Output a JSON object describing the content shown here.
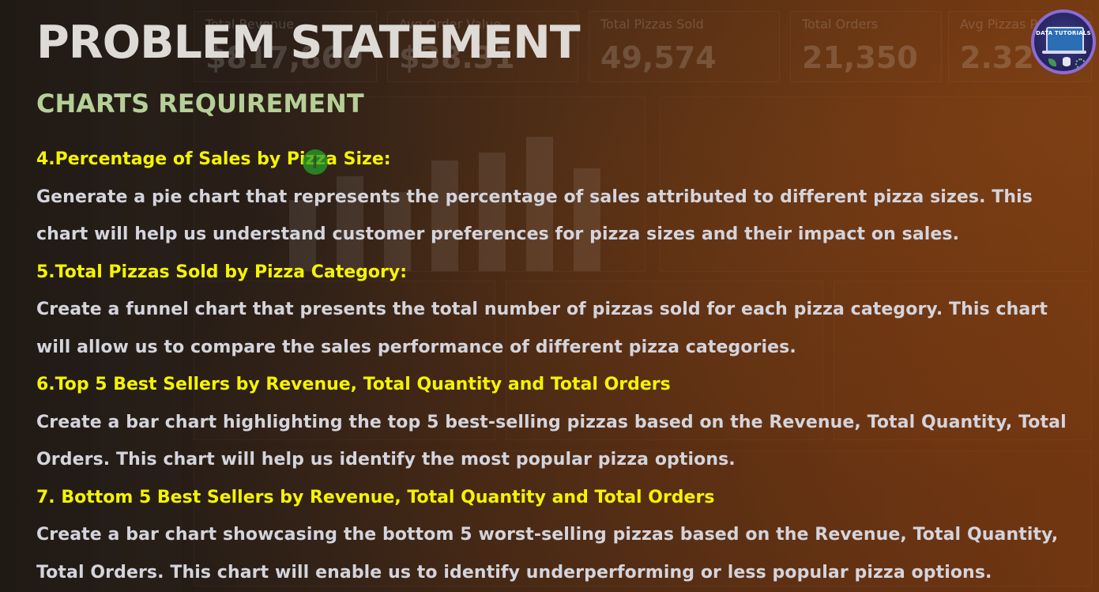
{
  "slide": {
    "title": "PROBLEM STATEMENT",
    "subtitle": "CHARTS REQUIREMENT",
    "logo_text": "DATA TUTORIALS"
  },
  "items": [
    {
      "heading": "4.Percentage of Sales by Pizza Size:",
      "description": "Generate a pie chart that represents the percentage of sales attributed to different pizza sizes. This chart will help us understand customer preferences for pizza sizes and their impact on sales."
    },
    {
      "heading": "5.Total Pizzas Sold by Pizza Category:",
      "description": "Create a funnel chart that presents the total number of pizzas sold for each pizza category. This chart will allow us to compare the sales performance of different pizza categories."
    },
    {
      "heading": "6.Top 5 Best Sellers by Revenue, Total Quantity and Total Orders",
      "description": "Create a bar chart highlighting the top 5 best-selling pizzas based on the Revenue, Total Quantity, Total Orders. This chart will help us identify the most popular pizza options."
    },
    {
      "heading": "7. Bottom 5 Best Sellers by Revenue, Total Quantity and Total Orders",
      "description": "Create a bar chart showcasing the bottom 5 worst-selling pizzas based on the Revenue, Total Quantity, Total Orders. This chart will enable us to identify underperforming or less popular pizza options."
    }
  ],
  "background_dashboard": {
    "kpis": [
      {
        "label": "Total Revenue",
        "value": "$817,860"
      },
      {
        "label": "Avg Order Value",
        "value": "$38.31"
      },
      {
        "label": "Total Pizzas Sold",
        "value": "49,574"
      },
      {
        "label": "Total Orders",
        "value": "21,350"
      },
      {
        "label": "Avg Pizzas Per Order",
        "value": "2.32"
      }
    ]
  },
  "colors": {
    "title": "#dedad6",
    "subtitle": "#b6cf97",
    "heading": "#f4f400",
    "body": "#d4d4dc"
  },
  "icons": [
    "data-tutorials-logo-icon",
    "cursor-icon"
  ]
}
